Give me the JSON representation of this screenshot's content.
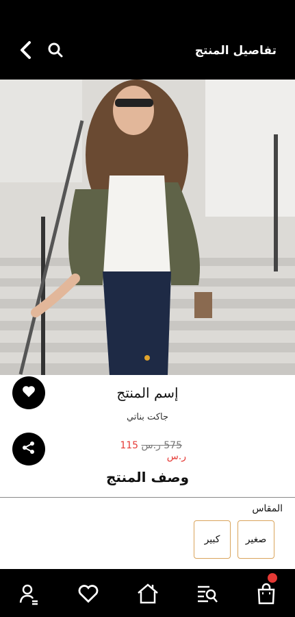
{
  "header": {
    "title": "تفاصيل المنتج"
  },
  "icons": {
    "back": "chevron-left-icon",
    "search": "search-icon",
    "favorite": "heart-icon",
    "share": "share-icon",
    "nav": [
      "profile-icon",
      "heart-icon",
      "home-icon",
      "search-list-icon",
      "cart-icon"
    ]
  },
  "product": {
    "name": "إسم المنتج",
    "subtitle": "جاكت بناتي",
    "price_new": "115 ر.س",
    "price_old": "575 ر.س",
    "description_title": "وصف المنتج"
  },
  "sizes": {
    "label": "المقاس",
    "options": [
      "صغير",
      "كبير"
    ]
  },
  "colors": {
    "accent": "#e0a32c",
    "sale": "#e53935",
    "bar": "#000000"
  }
}
